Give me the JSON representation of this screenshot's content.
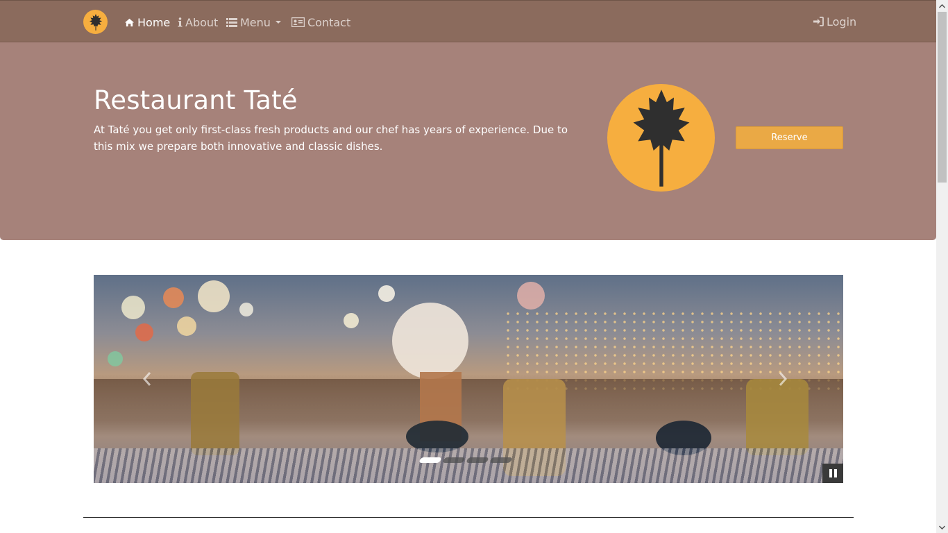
{
  "nav": {
    "items": [
      {
        "label": "Home",
        "icon": "home-icon",
        "active": true
      },
      {
        "label": "About",
        "icon": "info-icon",
        "active": false
      },
      {
        "label": "Menu",
        "icon": "list-icon",
        "active": false
      },
      {
        "label": "Contact",
        "icon": "contact-card-icon",
        "active": false
      }
    ],
    "login_label": "Login"
  },
  "hero": {
    "title": "Restaurant Taté",
    "description": "At Taté you get only first-class fresh products and our chef has years of experience. Due to this mix we prepare both innovative and classic dishes.",
    "reserve_label": "Reserve"
  },
  "carousel": {
    "prev_icon": "chevron-left-icon",
    "next_icon": "chevron-right-icon",
    "slide_count": 4,
    "active_slide": 1,
    "pause_icon": "pause-icon"
  },
  "colors": {
    "navbar": "#8b6b5d",
    "hero": "#a6827a",
    "accent": "#f6ae3f",
    "reserve": "#eaa945"
  }
}
